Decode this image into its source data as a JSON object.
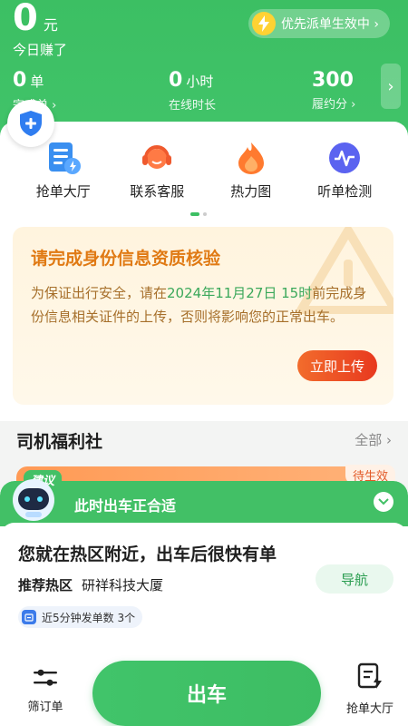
{
  "header": {
    "earnings_value": "0",
    "earnings_unit": "元",
    "earnings_label": "今日赚了",
    "priority_label": "优先派单生效中 ›",
    "stats": [
      {
        "value": "0",
        "unit": "单",
        "label": "完成单 ›"
      },
      {
        "value": "0",
        "unit": "小时",
        "label": "在线时长"
      },
      {
        "value": "300",
        "unit": "",
        "label": "履约分 ›"
      }
    ],
    "more_arrow": "›"
  },
  "quick_actions": [
    {
      "label": "抢单大厅",
      "icon": "order-hall-icon"
    },
    {
      "label": "联系客服",
      "icon": "customer-service-icon"
    },
    {
      "label": "热力图",
      "icon": "heatmap-icon"
    },
    {
      "label": "听单检测",
      "icon": "listen-check-icon"
    }
  ],
  "notice": {
    "title": "请完成身份信息资质核验",
    "body_prefix": "为保证出行安全，请在",
    "deadline": "2024年11月27日 15时",
    "body_suffix": "前完成身份信息相关证件的上传，否则将影响您的正常出车。",
    "button": "立即上传"
  },
  "welfare": {
    "title": "司机福利社",
    "all_link": "全部 ›",
    "suggest_tag": "建议",
    "pending_tag": "待生效"
  },
  "sheet": {
    "header_text": "此时出车正合适",
    "hot_title": "您就在热区附近，出车后很快有单",
    "hot_key": "推荐热区",
    "hot_value": "研祥科技大厦",
    "nav_button": "导航",
    "count_text": "近5分钟发单数 3个"
  },
  "bottom": {
    "filter_label": "筛订单",
    "go_button": "出车",
    "grab_label": "抢单大厅"
  },
  "colors": {
    "brand_green": "#3cbf63",
    "notice_orange": "#e07a14",
    "upload_red": "#e8391f"
  }
}
